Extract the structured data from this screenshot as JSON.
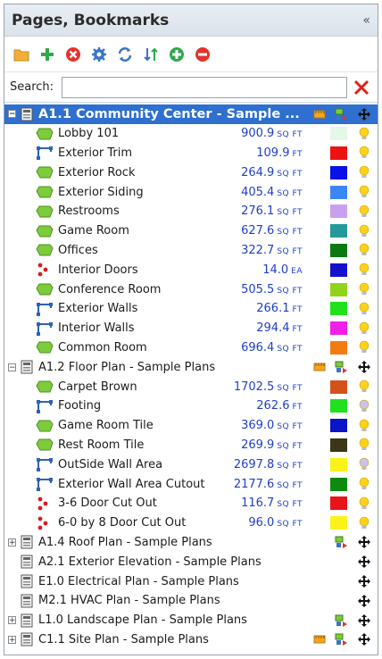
{
  "panel": {
    "title": "Pages, Bookmarks",
    "collapse_glyph": "«",
    "toolbar_icons": [
      "folder-icon",
      "add-icon",
      "delete-icon",
      "settings-gear-icon",
      "refresh-icon",
      "sort-icon",
      "add-circle-icon",
      "remove-circle-icon"
    ],
    "search_label": "Search:",
    "search_value": ""
  },
  "pages": [
    {
      "name": "A1.1 Community Center - Sample ...",
      "selected": true,
      "expanded": true,
      "conditions": [
        {
          "name": "Lobby 101",
          "type": "area",
          "qty": "900.9",
          "unit": "SQ FT",
          "color": "#e3f8e6",
          "bulb": "#ffd21a"
        },
        {
          "name": "Exterior Trim",
          "type": "linear",
          "qty": "109.9",
          "unit": "FT",
          "color": "#ee1111",
          "bulb": "#ffd21a"
        },
        {
          "name": "Exterior Rock",
          "type": "area",
          "qty": "264.9",
          "unit": "SQ FT",
          "color": "#0a10e8",
          "bulb": "#ffd21a"
        },
        {
          "name": "Exterior Siding",
          "type": "area",
          "qty": "405.4",
          "unit": "SQ FT",
          "color": "#3b86f5",
          "bulb": "#ffd21a"
        },
        {
          "name": "Restrooms",
          "type": "area",
          "qty": "276.1",
          "unit": "SQ FT",
          "color": "#c9a0f0",
          "bulb": "#ffd21a"
        },
        {
          "name": "Game Room",
          "type": "area",
          "qty": "627.6",
          "unit": "SQ FT",
          "color": "#239a99",
          "bulb": "#ffd21a"
        },
        {
          "name": "Offices",
          "type": "area",
          "qty": "322.7",
          "unit": "SQ FT",
          "color": "#0a7a10",
          "bulb": "#ffd21a"
        },
        {
          "name": "Interior Doors",
          "type": "count",
          "qty": "14.0",
          "unit": "EA",
          "color": "#1510cc",
          "bulb": "#ffd21a"
        },
        {
          "name": "Conference Room",
          "type": "area",
          "qty": "505.5",
          "unit": "SQ FT",
          "color": "#8fd41a",
          "bulb": "#ffd21a"
        },
        {
          "name": "Exterior Walls",
          "type": "linear",
          "qty": "266.1",
          "unit": "FT",
          "color": "#21e21a",
          "bulb": "#ffd21a"
        },
        {
          "name": "Interior Walls",
          "type": "linear",
          "qty": "294.4",
          "unit": "FT",
          "color": "#f020e6",
          "bulb": "#ffd21a"
        },
        {
          "name": "Common Room",
          "type": "area",
          "qty": "696.4",
          "unit": "SQ FT",
          "color": "#f47a12",
          "bulb": "#ffd21a"
        }
      ],
      "right_icons": [
        "measure-icon",
        "layers-icon",
        "pan-icon"
      ]
    },
    {
      "name": "A1.2 Floor Plan - Sample Plans",
      "selected": false,
      "expanded": true,
      "conditions": [
        {
          "name": "Carpet Brown",
          "type": "area",
          "qty": "1702.5",
          "unit": "SQ FT",
          "color": "#d4521a",
          "bulb": "#ffd21a"
        },
        {
          "name": "Footing",
          "type": "linear",
          "qty": "262.6",
          "unit": "FT",
          "color": "#20e020",
          "bulb": "#c9c2ef"
        },
        {
          "name": "Game Room Tile",
          "type": "area",
          "qty": "369.0",
          "unit": "SQ FT",
          "color": "#0b14c8",
          "bulb": "#ffd21a"
        },
        {
          "name": "Rest Room Tile",
          "type": "area",
          "qty": "269.9",
          "unit": "SQ FT",
          "color": "#3a3616",
          "bulb": "#ffd21a"
        },
        {
          "name": "OutSide Wall Area",
          "type": "linear",
          "qty": "2697.8",
          "unit": "SQ FT",
          "color": "#fbf21a",
          "bulb": "#c9c2ef"
        },
        {
          "name": "Exterior Wall Area Cutout",
          "type": "linear",
          "qty": "2177.6",
          "unit": "SQ FT",
          "color": "#0e8a10",
          "bulb": "#ffd21a"
        },
        {
          "name": "3-6 Door Cut Out",
          "type": "count",
          "qty": "116.7",
          "unit": "SQ FT",
          "color": "#e8141a",
          "bulb": "#ffd21a"
        },
        {
          "name": "6-0 by 8 Door Cut Out",
          "type": "count",
          "qty": "96.0",
          "unit": "SQ FT",
          "color": "#fbf21a",
          "bulb": "#ffd21a"
        }
      ],
      "right_icons": [
        "measure-icon",
        "layers-icon",
        "pan-icon"
      ]
    },
    {
      "name": "A1.4 Roof Plan - Sample Plans",
      "expandable": true,
      "right_icons": [
        "layers-icon",
        "pan-icon"
      ]
    },
    {
      "name": "A2.1 Exterior Elevation - Sample Plans",
      "expandable": false,
      "right_icons": [
        "pan-icon"
      ]
    },
    {
      "name": "E1.0 Electrical Plan - Sample Plans",
      "expandable": false,
      "right_icons": [
        "pan-icon"
      ]
    },
    {
      "name": "M2.1 HVAC Plan - Sample Plans",
      "expandable": false,
      "right_icons": [
        "pan-icon"
      ]
    },
    {
      "name": "L1.0 Landscape Plan - Sample Plans",
      "expandable": true,
      "right_icons": [
        "layers-icon",
        "pan-icon"
      ]
    },
    {
      "name": "C1.1 Site Plan - Sample Plans",
      "expandable": true,
      "right_icons": [
        "measure-icon",
        "layers-icon",
        "pan-icon"
      ]
    }
  ]
}
